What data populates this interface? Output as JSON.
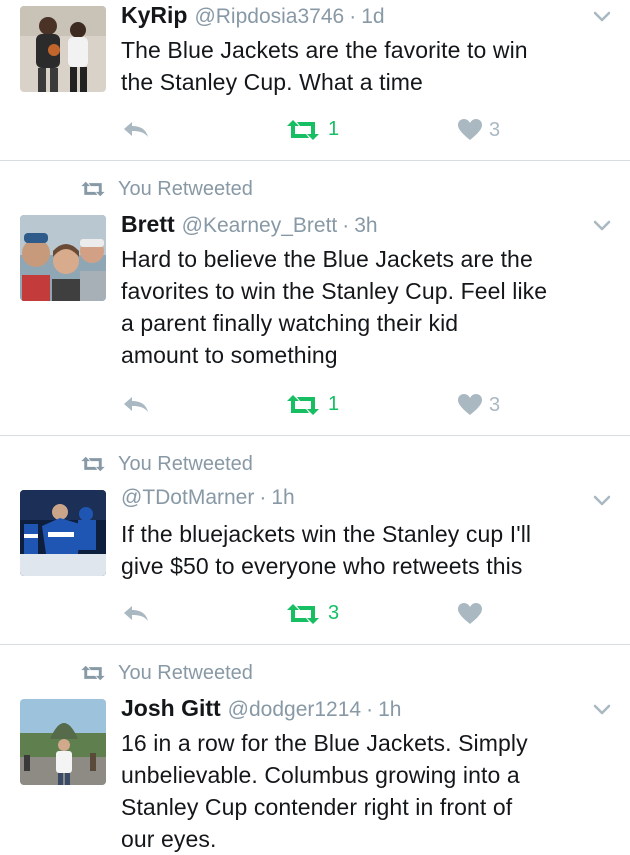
{
  "colors": {
    "retweet_green": "#17bf63",
    "gray": "#8899a6",
    "icon_gray": "#aab8c2",
    "divider": "#d9dde1"
  },
  "icons": {
    "reply": "reply-icon",
    "retweet": "retweet-icon",
    "like": "heart-icon",
    "menu": "chevron-down-icon"
  },
  "tweets": [
    {
      "retweeted_label": "",
      "name": "KyRip",
      "handle": "@Ripdosia3746",
      "dot": "·",
      "time": "1d",
      "text_lines": [
        "The Blue Jackets are the favorite to win",
        "the Stanley Cup. What a time"
      ],
      "retweets": "1",
      "likes": "3"
    },
    {
      "retweeted_label": "You Retweeted",
      "name": "Brett",
      "handle": "@Kearney_Brett",
      "dot": "·",
      "time": "3h",
      "text_lines": [
        "Hard to believe the Blue Jackets are the",
        "favorites to win the Stanley Cup. Feel like",
        "a parent finally watching their kid",
        "amount to something"
      ],
      "retweets": "1",
      "likes": "3"
    },
    {
      "retweeted_label": "You Retweeted",
      "name": "",
      "handle": "@TDotMarner",
      "dot": "·",
      "time": "1h",
      "text_lines": [
        "If the bluejackets win the Stanley cup I'll",
        "give $50 to everyone who retweets this"
      ],
      "retweets": "3",
      "likes": ""
    },
    {
      "retweeted_label": "You Retweeted",
      "name": "Josh Gitt",
      "handle": "@dodger1214",
      "dot": "·",
      "time": "1h",
      "text_lines": [
        "16 in a row for the Blue Jackets. Simply",
        "unbelievable. Columbus growing into a",
        "Stanley Cup contender right in front of",
        "our eyes."
      ],
      "retweets": "",
      "likes": ""
    }
  ]
}
